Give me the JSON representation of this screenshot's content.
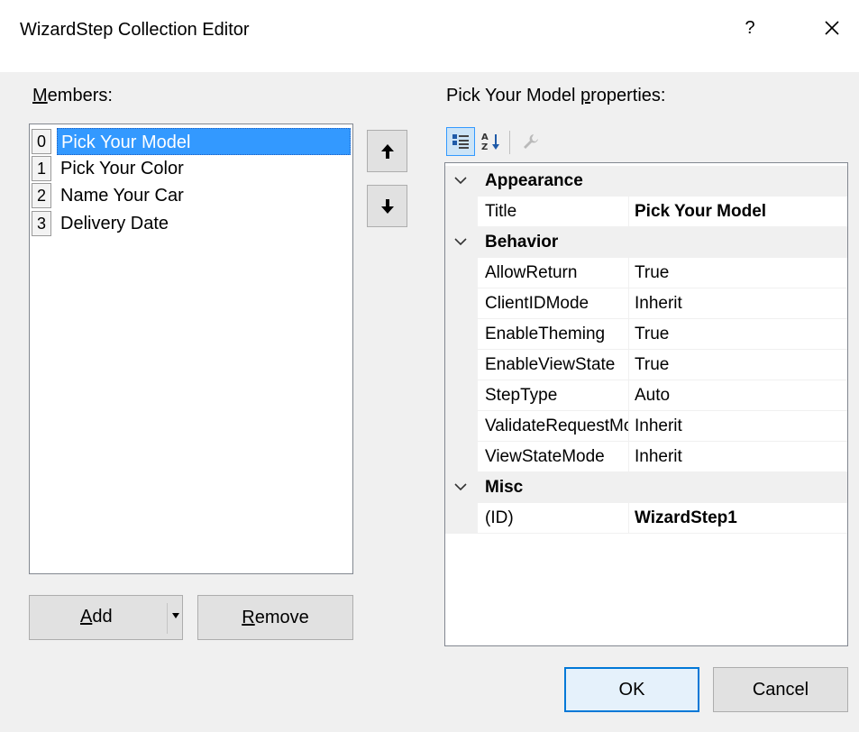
{
  "window": {
    "title": "WizardStep Collection Editor",
    "help": "?"
  },
  "members": {
    "label_pre": "",
    "label_key": "M",
    "label_post": "embers:",
    "items": [
      {
        "index": "0",
        "label": "Pick Your Model",
        "selected": true
      },
      {
        "index": "1",
        "label": "Pick Your Color",
        "selected": false
      },
      {
        "index": "2",
        "label": "Name Your Car",
        "selected": false
      },
      {
        "index": "3",
        "label": "Delivery Date",
        "selected": false
      }
    ]
  },
  "buttons": {
    "add_key": "A",
    "add_rest": "dd",
    "remove_key": "R",
    "remove_rest": "emove",
    "ok": "OK",
    "cancel": "Cancel"
  },
  "properties": {
    "label_pre": "Pick Your Model ",
    "label_key": "p",
    "label_post": "roperties:",
    "categories": [
      {
        "name": "Appearance",
        "rows": [
          {
            "name": "Title",
            "value": "Pick Your Model",
            "bold": true
          }
        ]
      },
      {
        "name": "Behavior",
        "rows": [
          {
            "name": "AllowReturn",
            "value": "True",
            "bold": false
          },
          {
            "name": "ClientIDMode",
            "value": "Inherit",
            "bold": false
          },
          {
            "name": "EnableTheming",
            "value": "True",
            "bold": false
          },
          {
            "name": "EnableViewState",
            "value": "True",
            "bold": false
          },
          {
            "name": "StepType",
            "value": "Auto",
            "bold": false
          },
          {
            "name": "ValidateRequestMode",
            "value": "Inherit",
            "bold": false
          },
          {
            "name": "ViewStateMode",
            "value": "Inherit",
            "bold": false
          }
        ]
      },
      {
        "name": "Misc",
        "rows": [
          {
            "name": "(ID)",
            "value": "WizardStep1",
            "bold": true
          }
        ]
      }
    ]
  },
  "colors": {
    "selection": "#3399ff",
    "accent": "#0078d7"
  }
}
